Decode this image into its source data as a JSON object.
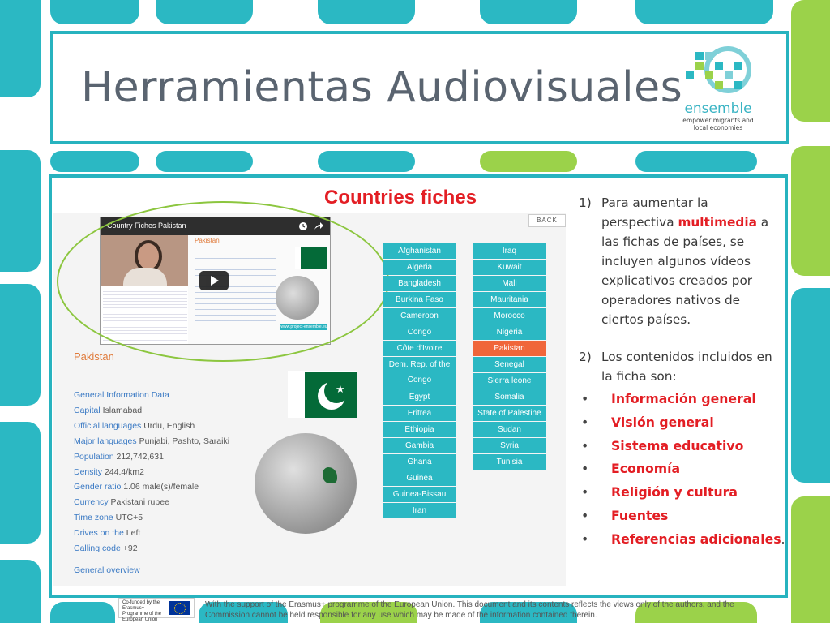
{
  "slide": {
    "title": "Herramientas Audiovisuales"
  },
  "logo": {
    "name": "ensemble",
    "tagline": "empower migrants and local economies"
  },
  "screenshot": {
    "heading": "Countries fiches",
    "back_label": "BACK",
    "video_title": "Country Fiches Pakistan",
    "video_country": "Pakistan",
    "video_link": "www.project-ensemble.eu",
    "country": "Pakistan",
    "info": [
      {
        "key": "General Information Data",
        "value": ""
      },
      {
        "key": "Capital",
        "value": "Islamabad"
      },
      {
        "key": "Official languages",
        "value": "Urdu, English"
      },
      {
        "key": "Major languages",
        "value": "Punjabi, Pashto, Saraiki"
      },
      {
        "key": "Population",
        "value": "212,742,631"
      },
      {
        "key": "Density",
        "value": "244.4/km2"
      },
      {
        "key": "Gender ratio",
        "value": "1.06 male(s)/female"
      },
      {
        "key": "Currency",
        "value": "Pakistani rupee"
      },
      {
        "key": "Time zone",
        "value": "UTC+5"
      },
      {
        "key": "Drives on the",
        "value": "Left"
      },
      {
        "key": "Calling code",
        "value": "+92"
      }
    ],
    "general_overview": "General overview",
    "countries_col1": [
      "Afghanistan",
      "Algeria",
      "Bangladesh",
      "Burkina Faso",
      "Cameroon",
      "Congo",
      "Côte d'Ivoire",
      "Dem. Rep. of the Congo",
      "Egypt",
      "Eritrea",
      "Ethiopia",
      "Gambia",
      "Ghana",
      "Guinea",
      "Guinea-Bissau",
      "Iran"
    ],
    "countries_col2": [
      "Iraq",
      "Kuwait",
      "Mali",
      "Mauritania",
      "Morocco",
      "Nigeria",
      "Pakistan",
      "Senegal",
      "Sierra leone",
      "Somalia",
      "State of Palestine",
      "Sudan",
      "Syria",
      "Tunisia"
    ],
    "selected_country": "Pakistan"
  },
  "text": {
    "point1_num": "1)",
    "point1_a": "Para aumentar la perspectiva ",
    "point1_highlight": "multimedia",
    "point1_b": " a las fichas de países, se incluyen algunos vídeos explicativos creados por operadores nativos de ciertos países.",
    "point2_num": "2)",
    "point2": "Los contenidos incluidos en la ficha son:",
    "bullet_mark": "•",
    "bullets": [
      "Información general",
      "Visión general",
      "Sistema educativo",
      "Economía",
      "Religión y cultura",
      "Fuentes",
      "Referencias adicionales"
    ],
    "bullets_end": "."
  },
  "footer": {
    "logo_text": "Co-funded by the Erasmus+ Programme of the European Union",
    "text": "With the support of the Erasmus+ programme of the European Union. This document and its contents reflects the views only of the authors, and the Commission cannot be held responsible for any use which may be made of the information contained therein."
  },
  "colors": {
    "teal": "#2bb8c3",
    "green": "#9bd24a",
    "selected": "#f0663a",
    "accent_red": "#e31e24",
    "pak_green": "#046a38"
  }
}
